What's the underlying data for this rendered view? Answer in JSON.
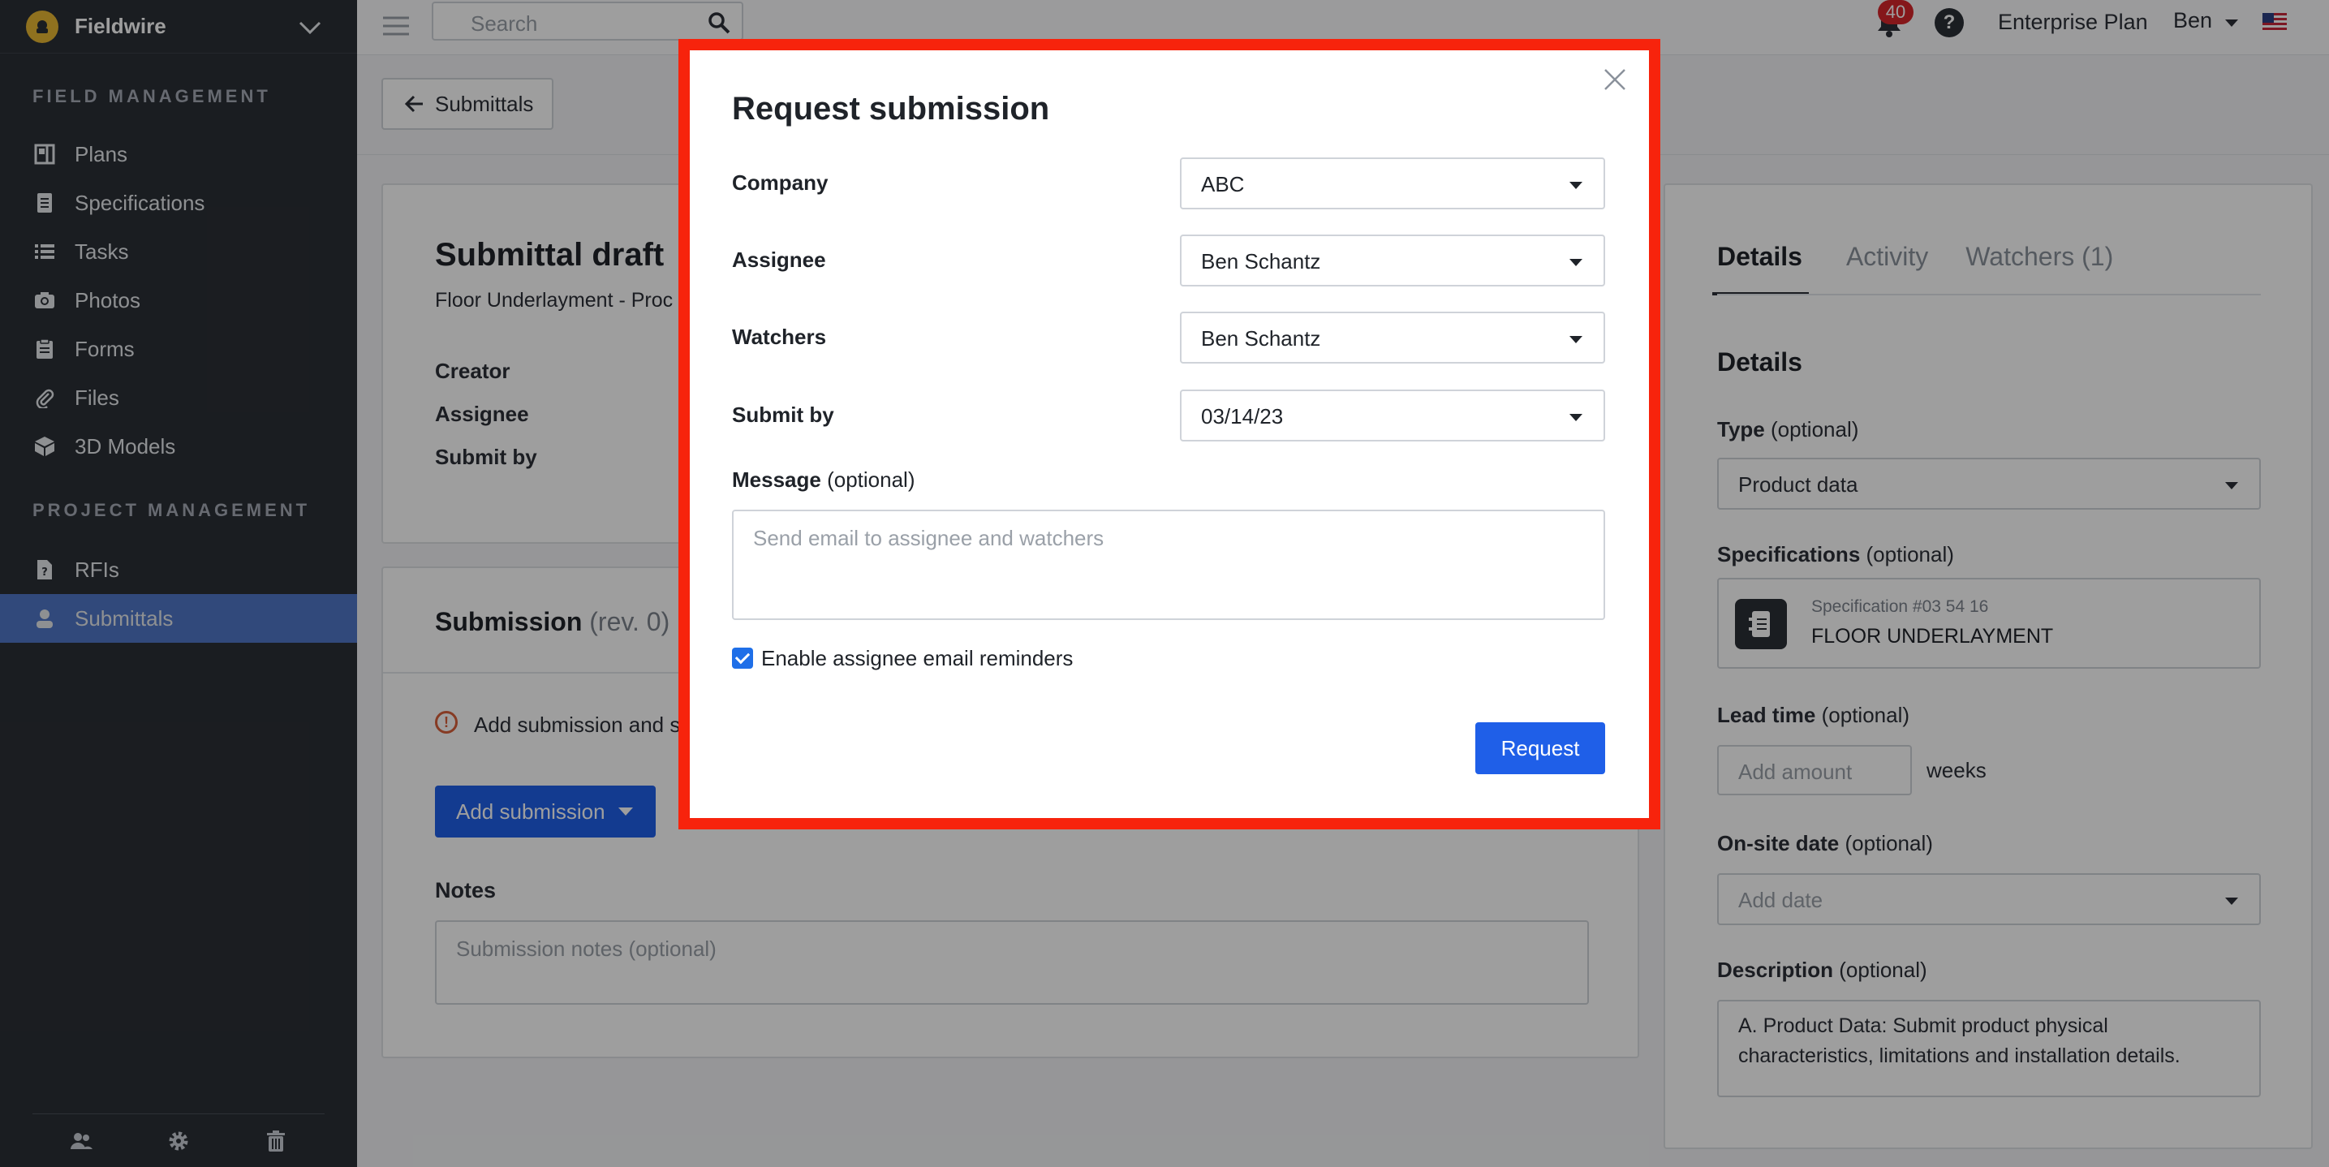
{
  "app": {
    "name": "Fieldwire"
  },
  "sidebar": {
    "field_label": "FIELD MANAGEMENT",
    "field_items": [
      {
        "label": "Plans",
        "icon": "plans-icon"
      },
      {
        "label": "Specifications",
        "icon": "specifications-icon"
      },
      {
        "label": "Tasks",
        "icon": "tasks-icon"
      },
      {
        "label": "Photos",
        "icon": "camera-icon"
      },
      {
        "label": "Forms",
        "icon": "clipboard-icon"
      },
      {
        "label": "Files",
        "icon": "paperclip-icon"
      },
      {
        "label": "3D Models",
        "icon": "cube-icon"
      }
    ],
    "project_label": "PROJECT MANAGEMENT",
    "project_items": [
      {
        "label": "RFIs",
        "icon": "rfi-icon"
      },
      {
        "label": "Submittals",
        "icon": "submittals-icon",
        "active": true
      }
    ],
    "footer_icons": [
      "people-icon",
      "gear-icon",
      "trash-icon"
    ]
  },
  "topbar": {
    "search_placeholder": "Search",
    "notification_count": "40",
    "help_glyph": "?",
    "plan": "Enterprise Plan",
    "user": "Ben"
  },
  "back_button": "Submittals",
  "draft": {
    "title": "Submittal draft",
    "subtitle": "Floor Underlayment - Proc",
    "creator_label": "Creator",
    "assignee_label": "Assignee",
    "submit_by_label": "Submit by"
  },
  "submission": {
    "title": "Submission",
    "rev": "(rev. 0)",
    "warning": "Add submission and su",
    "warning_glyph": "!",
    "add_button": "Add submission",
    "notes_label": "Notes",
    "notes_placeholder": "Submission notes (optional)"
  },
  "details_panel": {
    "tabs": [
      "Details",
      "Activity",
      "Watchers (1)"
    ],
    "heading": "Details",
    "optional": "(optional)",
    "type_label": "Type",
    "type_value": "Product data",
    "spec_label": "Specifications",
    "spec_number": "Specification #03 54 16",
    "spec_name": "FLOOR UNDERLAYMENT",
    "lead_label": "Lead time",
    "lead_placeholder": "Add amount",
    "lead_unit": "weeks",
    "onsite_label": "On-site date",
    "onsite_placeholder": "Add date",
    "description_label": "Description",
    "description_line1": "A. Product Data:  Submit product physical",
    "description_line2": "characteristics, limitations and installation details."
  },
  "modal": {
    "title": "Request submission",
    "company_label": "Company",
    "company_value": "ABC",
    "assignee_label": "Assignee",
    "assignee_value": "Ben Schantz",
    "watchers_label": "Watchers",
    "watchers_value": "Ben Schantz",
    "submit_by_label": "Submit by",
    "submit_by_value": "03/14/23",
    "message_label": "Message",
    "message_optional": "(optional)",
    "message_placeholder": "Send email to assignee and watchers",
    "reminders_label": "Enable assignee email reminders",
    "reminders_checked": true,
    "request_button": "Request"
  },
  "colors": {
    "sidebar_bg": "#2b2f36",
    "active_nav": "#4f77c7",
    "primary_button": "#1f5fe8",
    "highlight_border": "#f7230c",
    "badge": "#d7262b"
  }
}
